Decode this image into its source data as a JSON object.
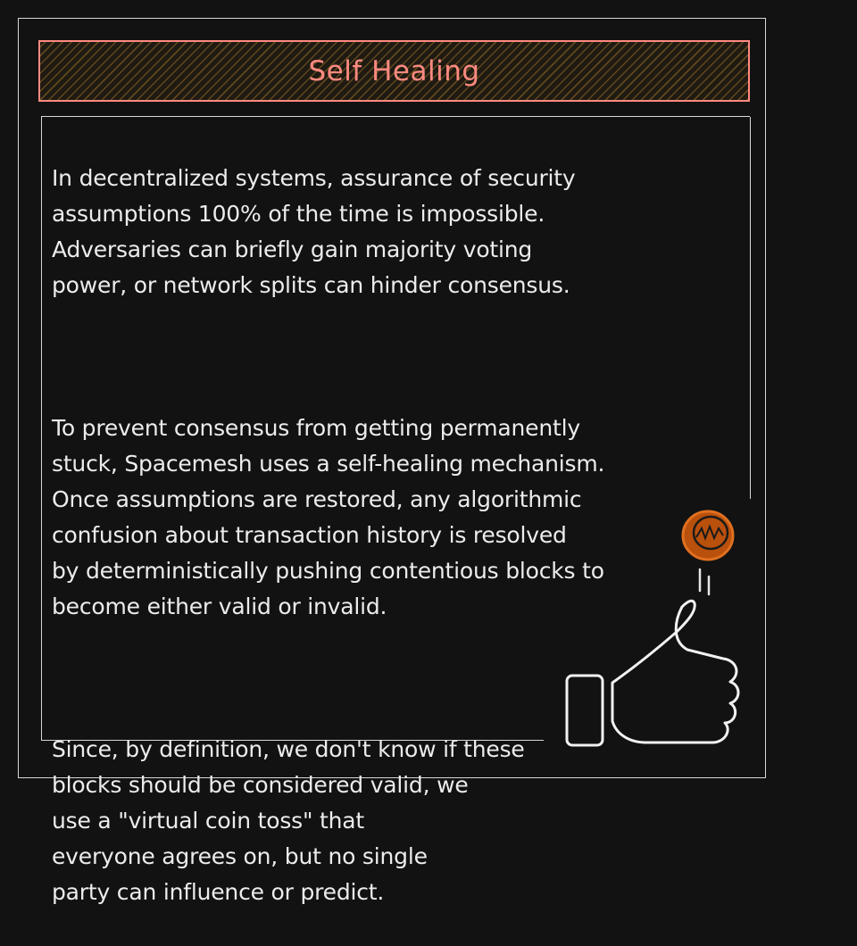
{
  "title": "Self Healing",
  "paragraphs": [
    "In decentralized systems, assurance of security\nassumptions 100% of the time is impossible.\nAdversaries can briefly gain majority voting\npower, or network splits can hinder consensus.",
    "To prevent consensus from getting permanently\nstuck, Spacemesh uses a self-healing mechanism.\nOnce assumptions are restored, any algorithmic\nconfusion about transaction history is resolved\nby deterministically pushing contentious blocks to\nbecome either valid or invalid.",
    "Since, by definition, we don't know if these\nblocks should be considered valid, we\nuse a \"virtual coin toss\" that\neveryone agrees on, but no single\nparty can influence or predict."
  ],
  "colors": {
    "background": "#121212",
    "title": "#ff8a80",
    "text": "#ececec",
    "coin": "#c85a10"
  },
  "icons": [
    "coin-icon",
    "thumbs-up-icon"
  ]
}
